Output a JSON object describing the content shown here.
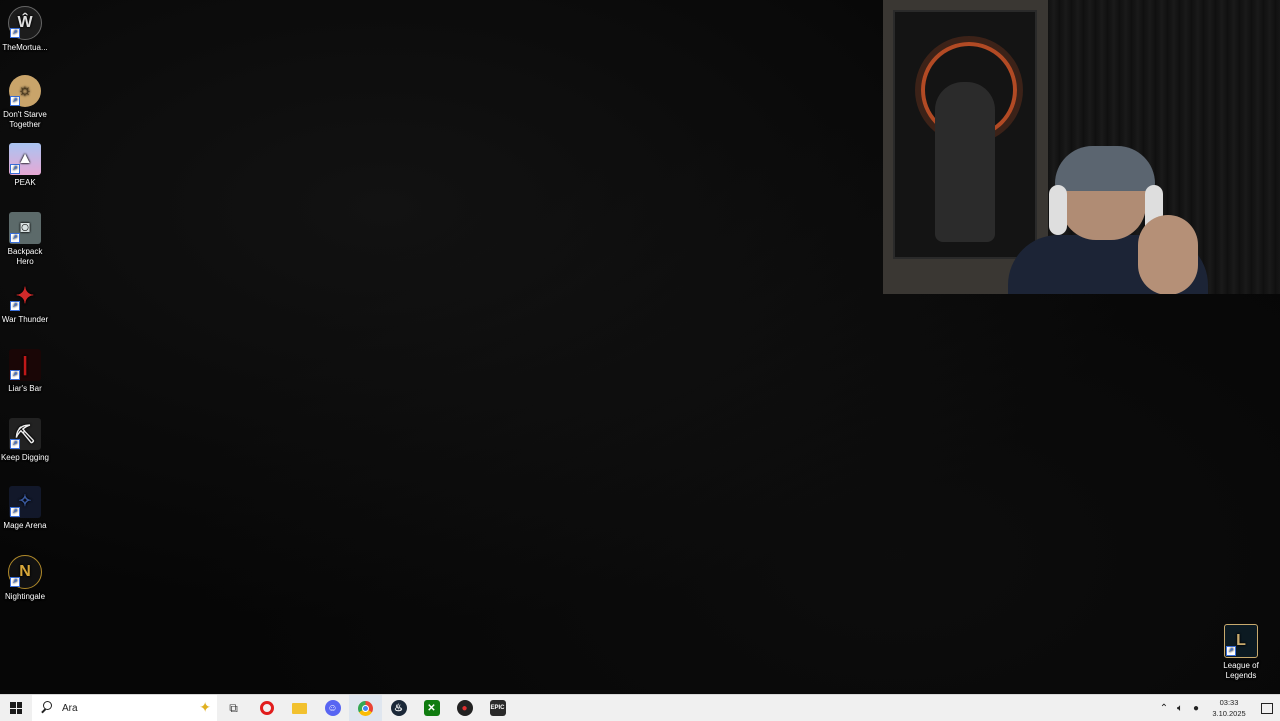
{
  "desktop_icons": [
    {
      "label": "TheMortua...",
      "icon": "themortuary-icon",
      "color": "#1c1c1c"
    },
    {
      "label": "Don't Starve Together",
      "icon": "dont-starve-icon",
      "color": "#c9a46a"
    },
    {
      "label": "PEAK",
      "icon": "peak-icon",
      "color": "#7f9ed6"
    },
    {
      "label": "Backpack Hero",
      "icon": "backpack-hero-icon",
      "color": "#5c6a6a"
    },
    {
      "label": "War Thunder",
      "icon": "war-thunder-icon",
      "color": "#c02828"
    },
    {
      "label": "Liar's Bar",
      "icon": "liars-bar-icon",
      "color": "#8a1010"
    },
    {
      "label": "Keep Digging",
      "icon": "keep-digging-icon",
      "color": "#222222"
    },
    {
      "label": "Mage Arena",
      "icon": "mage-arena-icon",
      "color": "#12182a"
    },
    {
      "label": "Nightingale",
      "icon": "nightingale-icon",
      "color": "#b08a2a"
    }
  ],
  "league_icon": {
    "label": "League of Legends",
    "icon": "league-of-legends-icon"
  },
  "taskbar": {
    "search_placeholder": "Ara",
    "apps": [
      {
        "name": "task-view",
        "icon": "task-view-icon",
        "color": "#333333"
      },
      {
        "name": "opera",
        "icon": "opera-icon",
        "color": "#e11d1d"
      },
      {
        "name": "file-explorer",
        "icon": "folder-icon",
        "color": "#f2c12e"
      },
      {
        "name": "discord",
        "icon": "discord-icon",
        "color": "#5865f2"
      },
      {
        "name": "chrome",
        "icon": "chrome-icon",
        "color": "#34a853"
      },
      {
        "name": "steam",
        "icon": "steam-icon",
        "color": "#1b2838"
      },
      {
        "name": "xbox",
        "icon": "xbox-icon",
        "color": "#107c10"
      },
      {
        "name": "app-red",
        "icon": "red-app-icon",
        "color": "#c81e1e"
      },
      {
        "name": "epic-games",
        "icon": "epic-games-icon",
        "color": "#2a2a2a"
      }
    ],
    "time": "03:33",
    "date": "3.10.2025"
  }
}
